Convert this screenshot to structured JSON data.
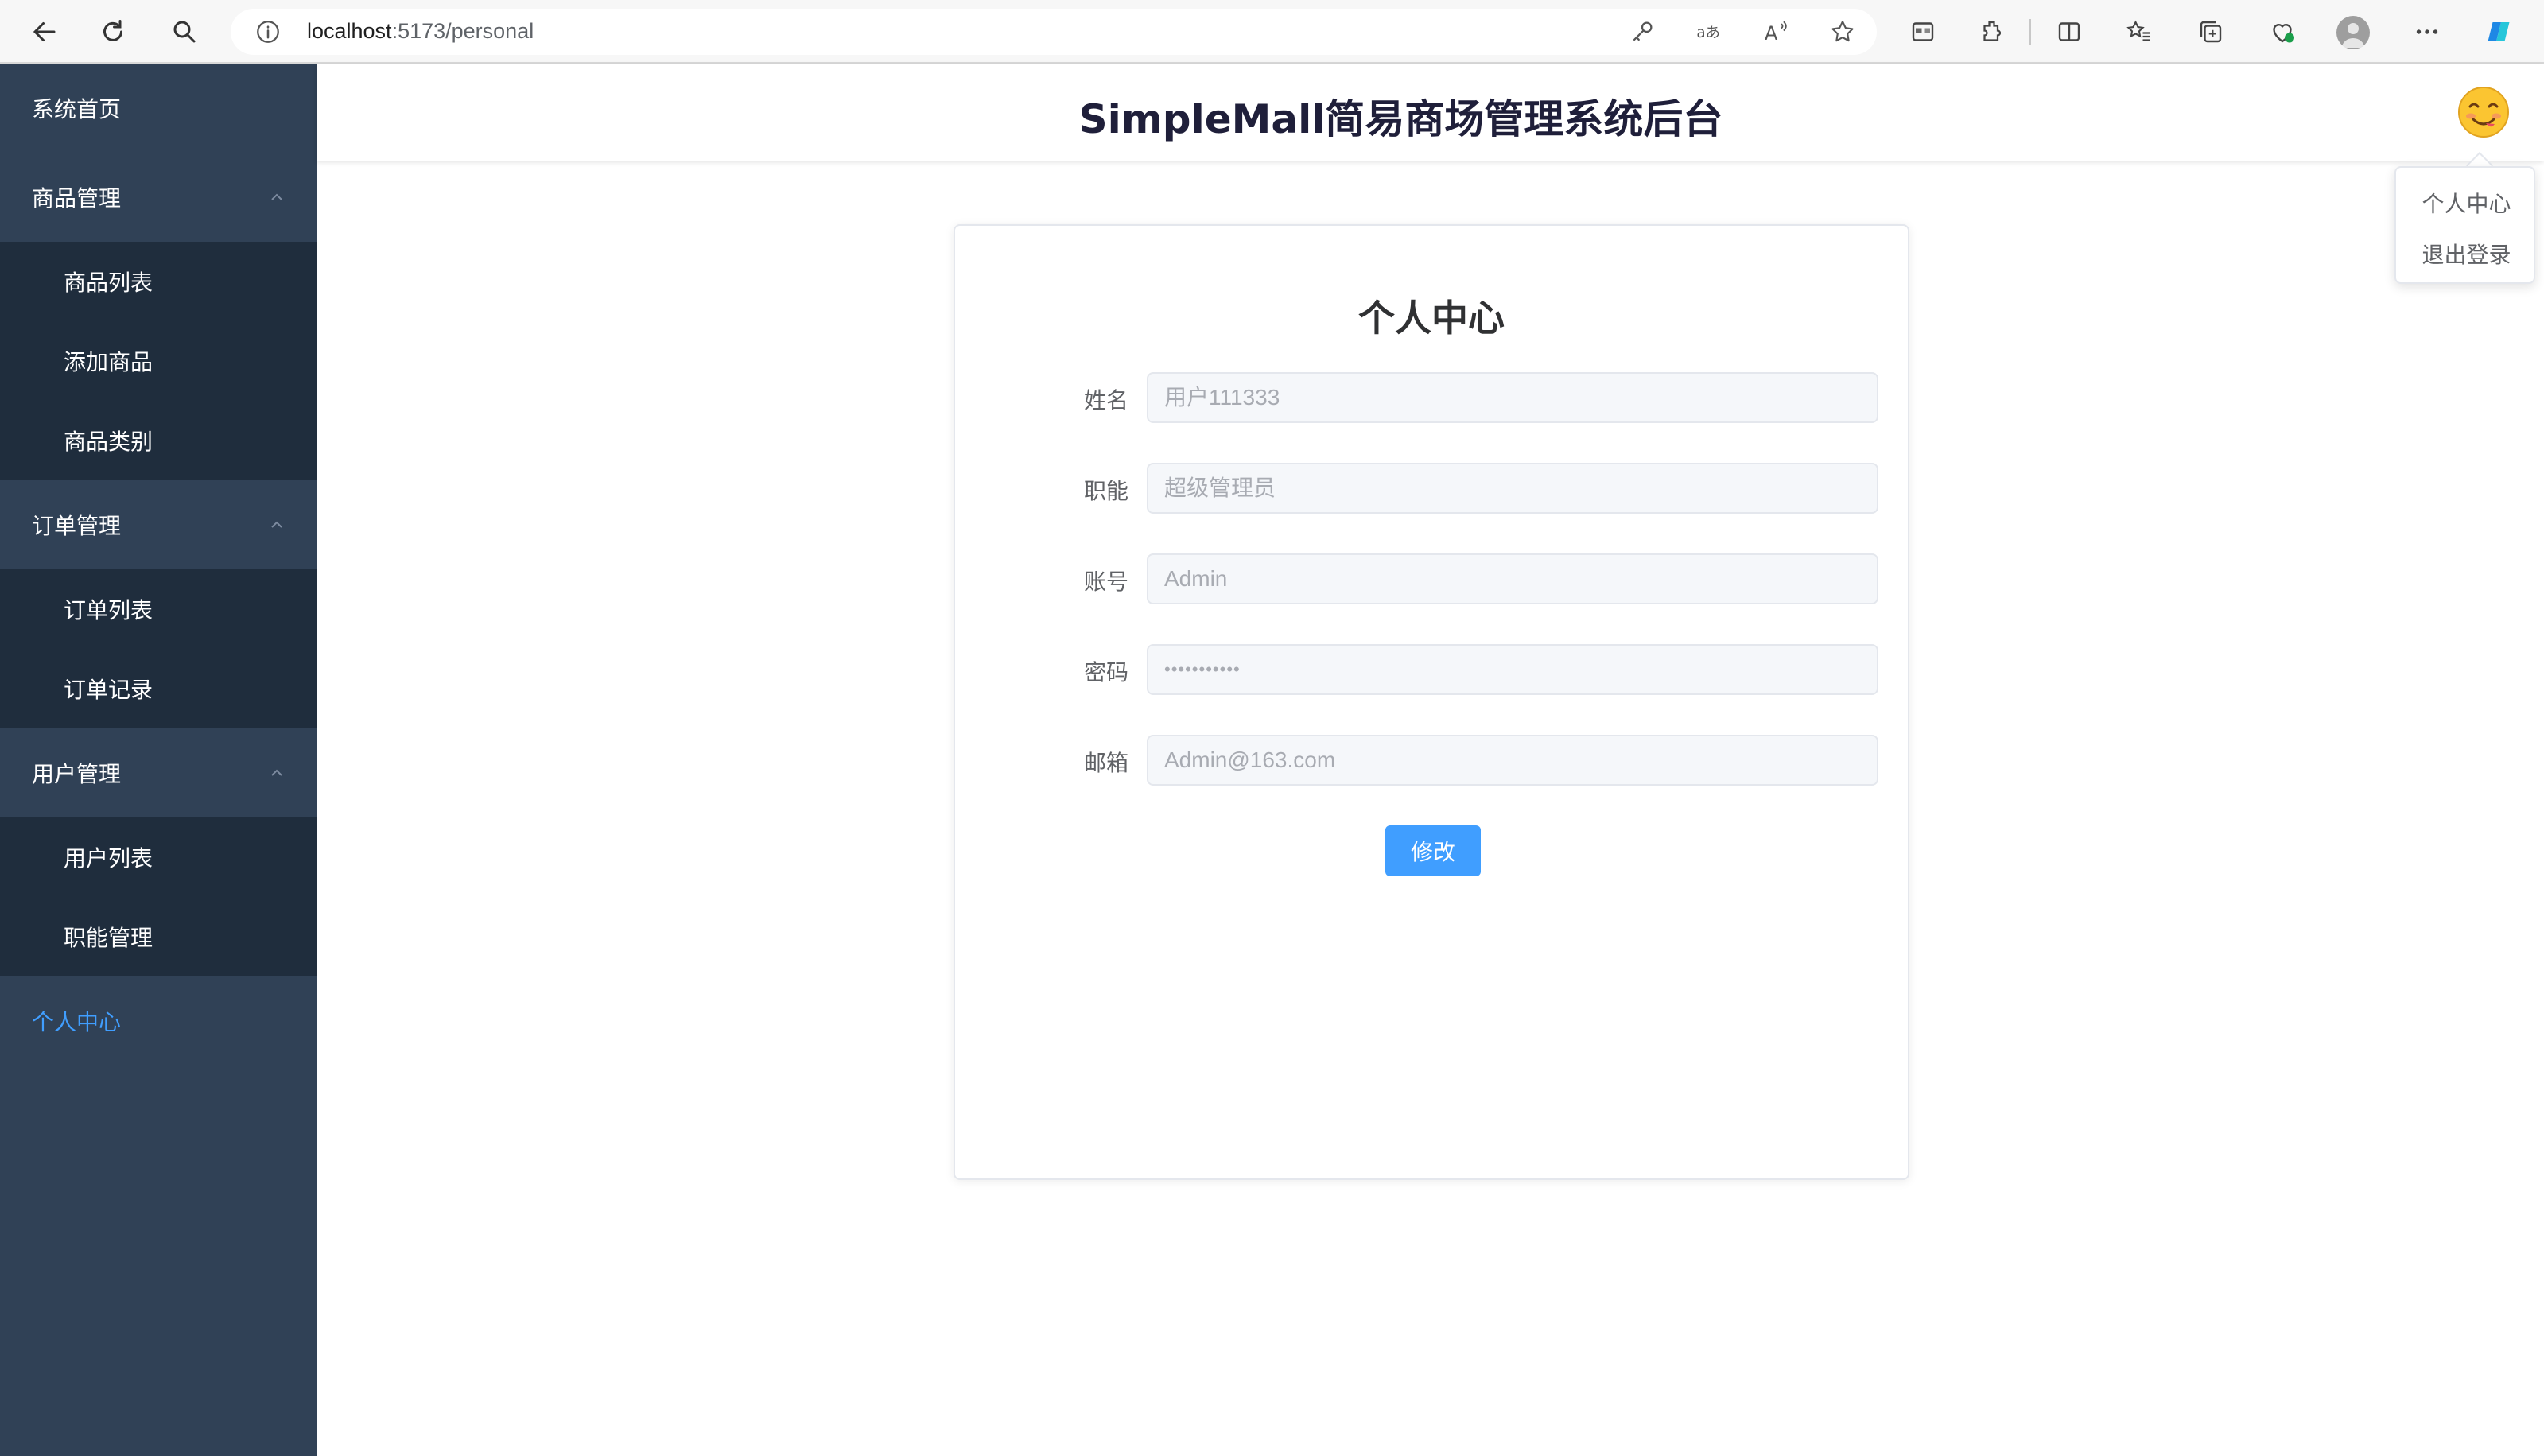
{
  "browser": {
    "url_host": "localhost",
    "url_path": ":5173/personal"
  },
  "sidebar": {
    "home": "系统首页",
    "groups": [
      {
        "label": "商品管理",
        "items": [
          "商品列表",
          "添加商品",
          "商品类别"
        ]
      },
      {
        "label": "订单管理",
        "items": [
          "订单列表",
          "订单记录"
        ]
      },
      {
        "label": "用户管理",
        "items": [
          "用户列表",
          "职能管理"
        ]
      }
    ],
    "personal": "个人中心"
  },
  "header": {
    "title": "SimpleMall简易商场管理系统后台"
  },
  "dropdown": {
    "items": [
      "个人中心",
      "退出登录"
    ]
  },
  "card": {
    "title": "个人中心",
    "fields": [
      {
        "label": "姓名",
        "value": "用户111333"
      },
      {
        "label": "职能",
        "value": "超级管理员"
      },
      {
        "label": "账号",
        "value": "Admin"
      },
      {
        "label": "密码",
        "value": "•••••••••••"
      },
      {
        "label": "邮箱",
        "value": "Admin@163.com"
      }
    ],
    "submit": "修改"
  },
  "colors": {
    "sidebar_bg": "#304156",
    "submenu_bg": "#1f2d3d",
    "accent": "#409eff"
  }
}
